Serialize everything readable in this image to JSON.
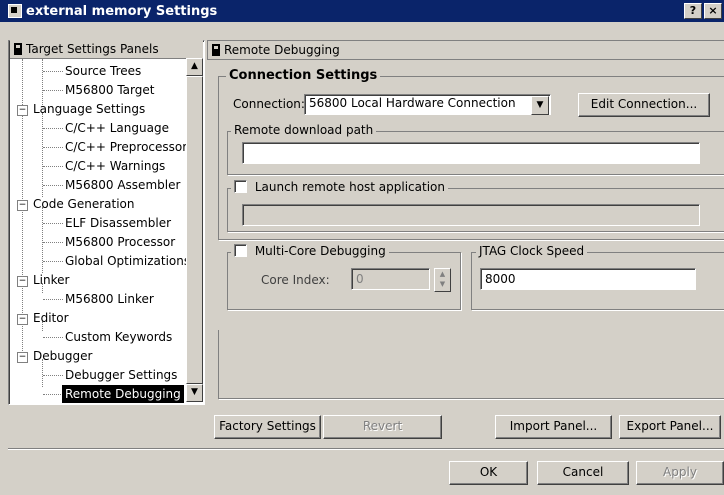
{
  "window": {
    "title": "external memory Settings",
    "help_label": "?",
    "close_label": "×"
  },
  "left_panel": {
    "header": "Target Settings Panels",
    "items": [
      {
        "label": "Source Trees"
      },
      {
        "label": "M56800 Target"
      },
      {
        "label": "Language Settings"
      },
      {
        "label": "C/C++ Language"
      },
      {
        "label": "C/C++ Preprocessor"
      },
      {
        "label": "C/C++ Warnings"
      },
      {
        "label": "M56800 Assembler"
      },
      {
        "label": "Code Generation"
      },
      {
        "label": "ELF Disassembler"
      },
      {
        "label": "M56800 Processor"
      },
      {
        "label": "Global Optimizations"
      },
      {
        "label": "Linker"
      },
      {
        "label": "M56800 Linker"
      },
      {
        "label": "Editor"
      },
      {
        "label": "Custom Keywords"
      },
      {
        "label": "Debugger"
      },
      {
        "label": "Debugger Settings"
      },
      {
        "label": "Remote Debugging"
      }
    ],
    "expander": "−"
  },
  "right_panel": {
    "header": "Remote Debugging",
    "connection_group": "Connection Settings",
    "connection_label": "Connection:",
    "connection_value": "56800 Local Hardware Connection",
    "edit_connection": "Edit Connection...",
    "download_group": "Remote download path",
    "download_value": "",
    "launch_label": "Launch remote host application",
    "launch_value": "",
    "multicore_label": "Multi-Core Debugging",
    "core_index_label": "Core Index:",
    "core_index_value": "0",
    "jtag_group": "JTAG Clock Speed",
    "jtag_value": "8000"
  },
  "buttons": {
    "factory": "Factory Settings",
    "revert": "Revert",
    "import": "Import Panel...",
    "export": "Export Panel...",
    "ok": "OK",
    "cancel": "Cancel",
    "apply": "Apply"
  }
}
